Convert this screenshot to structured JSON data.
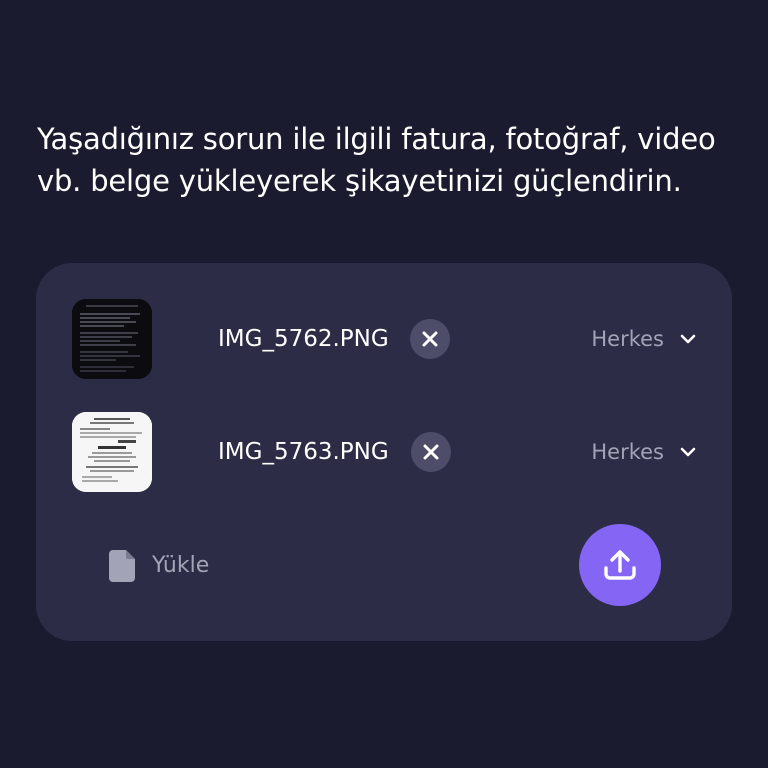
{
  "prompt": {
    "text": "Yaşadığınız sorun ile ilgili fatura, fotoğraf, video vb. belge yükleyerek şikayetinizi güçlendirin."
  },
  "attachments": [
    {
      "file_name": "IMG_5762.PNG",
      "visibility": "Herkes",
      "thumbnail": "dark-screenshot"
    },
    {
      "file_name": "IMG_5763.PNG",
      "visibility": "Herkes",
      "thumbnail": "receipt-screenshot"
    }
  ],
  "upload": {
    "label": "Yükle",
    "icon": "document-icon",
    "button_icon": "upload-icon"
  },
  "colors": {
    "background": "#1b1b2f",
    "card": "#2c2c46",
    "accent": "#8566f4",
    "muted_text": "#a3a3b7",
    "remove_button": "#4d4d69"
  }
}
